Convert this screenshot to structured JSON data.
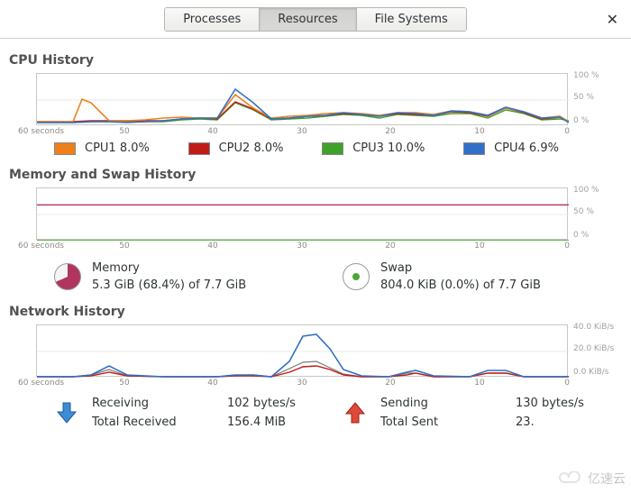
{
  "tabs": {
    "processes": "Processes",
    "resources": "Resources",
    "filesystems": "File Systems"
  },
  "sections": {
    "cpu_title": "CPU History",
    "mem_title": "Memory and Swap History",
    "net_title": "Network History"
  },
  "axis": {
    "x_left": "60 seconds",
    "x_50": "50",
    "x_40": "40",
    "x_30": "30",
    "x_20": "20",
    "x_10": "10",
    "x_0": "0"
  },
  "cpu": {
    "y_100": "100 %",
    "y_50": "50 %",
    "y_0": "0 %",
    "legend": [
      {
        "label": "CPU1  8.0%",
        "color": "#ef7f1a"
      },
      {
        "label": "CPU2  8.0%",
        "color": "#c11b17"
      },
      {
        "label": "CPU3  10.0%",
        "color": "#3ea12a"
      },
      {
        "label": "CPU4  6.9%",
        "color": "#3170c7"
      }
    ]
  },
  "mem": {
    "y_100": "100 %",
    "y_50": "50 %",
    "y_0": "0 %",
    "memory_label": "Memory",
    "memory_value": "5.3 GiB (68.4%) of 7.7 GiB",
    "swap_label": "Swap",
    "swap_value": "804.0 KiB (0.0%) of 7.7 GiB"
  },
  "net": {
    "y_40": "40.0 KiB/s",
    "y_20": "20.0 KiB/s",
    "y_0": "0.0 KiB/s",
    "recv_label": "Receiving",
    "recv_rate": "102 bytes/s",
    "recv_total_label": "Total Received",
    "recv_total": "156.4 MiB",
    "send_label": "Sending",
    "send_rate": "130 bytes/s",
    "send_total_label": "Total Sent",
    "send_total": "23."
  },
  "watermark": "亿速云",
  "chart_data": [
    {
      "type": "line",
      "title": "CPU History",
      "xlabel": "seconds",
      "ylabel": "%",
      "ylim": [
        0,
        100
      ],
      "x": [
        60,
        58,
        56,
        54,
        52,
        50,
        48,
        46,
        44,
        42,
        40,
        38,
        36,
        34,
        32,
        30,
        28,
        26,
        24,
        22,
        20,
        18,
        16,
        14,
        12,
        10,
        8,
        6,
        4,
        2,
        0
      ],
      "series": [
        {
          "name": "CPU1",
          "color": "#ef7f1a",
          "values": [
            8,
            8,
            9,
            52,
            44,
            10,
            10,
            11,
            15,
            17,
            16,
            60,
            35,
            15,
            18,
            20,
            22,
            26,
            24,
            20,
            26,
            25,
            22,
            30,
            28,
            20,
            35,
            27,
            15,
            18,
            8
          ]
        },
        {
          "name": "CPU2",
          "color": "#c11b17",
          "values": [
            8,
            8,
            8,
            10,
            10,
            9,
            9,
            10,
            13,
            15,
            14,
            47,
            33,
            13,
            15,
            18,
            20,
            24,
            22,
            18,
            24,
            23,
            20,
            28,
            26,
            18,
            34,
            26,
            14,
            16,
            8
          ]
        },
        {
          "name": "CPU3",
          "color": "#3ea12a",
          "values": [
            7,
            7,
            7,
            8,
            8,
            8,
            8,
            9,
            12,
            13,
            12,
            45,
            30,
            12,
            14,
            16,
            18,
            22,
            20,
            16,
            22,
            21,
            18,
            25,
            24,
            16,
            31,
            24,
            12,
            14,
            10
          ]
        },
        {
          "name": "CPU4",
          "color": "#3170c7",
          "values": [
            7,
            7,
            7,
            8,
            8,
            7,
            8,
            10,
            14,
            16,
            15,
            70,
            45,
            14,
            16,
            19,
            21,
            25,
            23,
            19,
            25,
            24,
            21,
            29,
            27,
            20,
            36,
            28,
            15,
            16,
            7
          ]
        }
      ]
    },
    {
      "type": "line",
      "title": "Memory and Swap History",
      "xlabel": "seconds",
      "ylabel": "%",
      "ylim": [
        0,
        100
      ],
      "x": [
        60,
        0
      ],
      "series": [
        {
          "name": "Memory",
          "color": "#b0355f",
          "values": [
            68.4,
            68.4
          ]
        },
        {
          "name": "Swap",
          "color": "#49a835",
          "values": [
            0.0,
            0.0
          ]
        }
      ]
    },
    {
      "type": "line",
      "title": "Network History",
      "xlabel": "seconds",
      "ylabel": "KiB/s",
      "ylim": [
        0,
        40
      ],
      "x": [
        60,
        58,
        56,
        54,
        52,
        50,
        48,
        46,
        44,
        42,
        40,
        38,
        36,
        34,
        32,
        30,
        28,
        26,
        24,
        22,
        20,
        18,
        16,
        14,
        12,
        10,
        8,
        6,
        4,
        2,
        0
      ],
      "series": [
        {
          "name": "Receiving",
          "color": "#3170c7",
          "values": [
            0.1,
            0.1,
            0.2,
            2,
            8,
            2,
            0.2,
            0.2,
            0.2,
            0.2,
            0.3,
            2,
            2,
            0.3,
            12,
            32,
            35,
            22,
            6,
            1,
            0.2,
            4,
            5,
            1,
            0.2,
            5,
            6,
            0.3,
            0.2,
            0.1,
            0.1
          ]
        },
        {
          "name": "Sending",
          "color": "#c11b17",
          "values": [
            0.1,
            0.1,
            0.2,
            1,
            4,
            1,
            0.1,
            0.1,
            0.1,
            0.1,
            0.2,
            1,
            1,
            0.2,
            4,
            8,
            9,
            6,
            2,
            0.5,
            0.1,
            2,
            3,
            0.5,
            0.1,
            3,
            3,
            0.2,
            0.1,
            0.1,
            0.1
          ]
        }
      ]
    }
  ]
}
